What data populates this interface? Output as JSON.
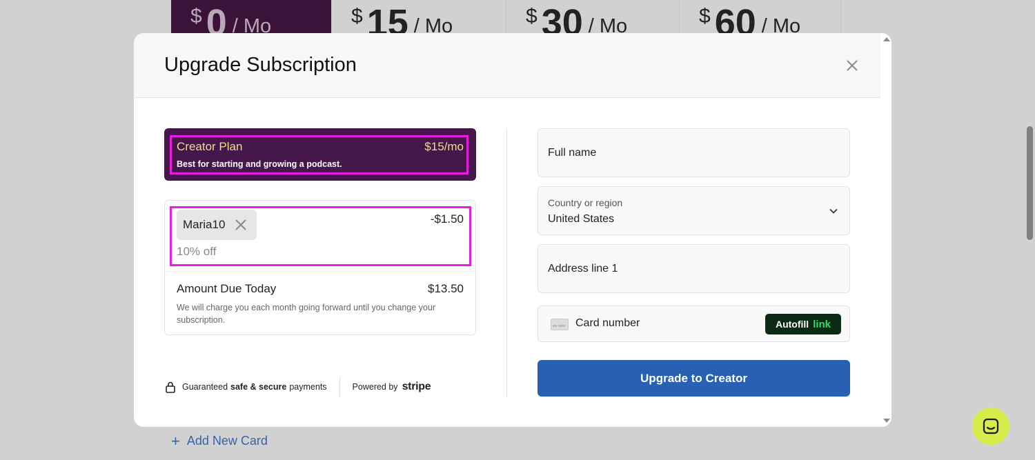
{
  "background": {
    "plans": [
      {
        "currency": "$",
        "amount": "0",
        "period": "/ Mo"
      },
      {
        "currency": "$",
        "amount": "15",
        "period": "/ Mo"
      },
      {
        "currency": "$",
        "amount": "30",
        "period": "/ Mo"
      },
      {
        "currency": "$",
        "amount": "60",
        "period": "/ Mo"
      }
    ],
    "add_card_label": "Add New Card"
  },
  "modal": {
    "title": "Upgrade Subscription",
    "plan": {
      "name": "Creator Plan",
      "price": "$15/mo",
      "description": "Best for starting and growing a podcast."
    },
    "coupon": {
      "code": "Maria10",
      "discount": "-$1.50",
      "percent_label": "10% off"
    },
    "amount_due": {
      "label": "Amount Due Today",
      "value": "$13.50",
      "note": "We will charge you each month going forward until you change your subscription."
    },
    "trust": {
      "prefix": "Guaranteed",
      "bold": "safe & secure",
      "suffix": "payments",
      "powered_by": "Powered by",
      "brand": "stripe"
    },
    "form": {
      "full_name_placeholder": "Full name",
      "country_label": "Country or region",
      "country_value": "United States",
      "address_placeholder": "Address line 1",
      "card_placeholder": "Card number",
      "autofill_label": "Autofill",
      "autofill_link": "link"
    },
    "submit_label": "Upgrade to Creator"
  },
  "colors": {
    "plan_bg": "#46174a",
    "highlight": "#e91ce4",
    "primary_button": "#2860b4",
    "chat_bubble": "#d6ec4a"
  }
}
